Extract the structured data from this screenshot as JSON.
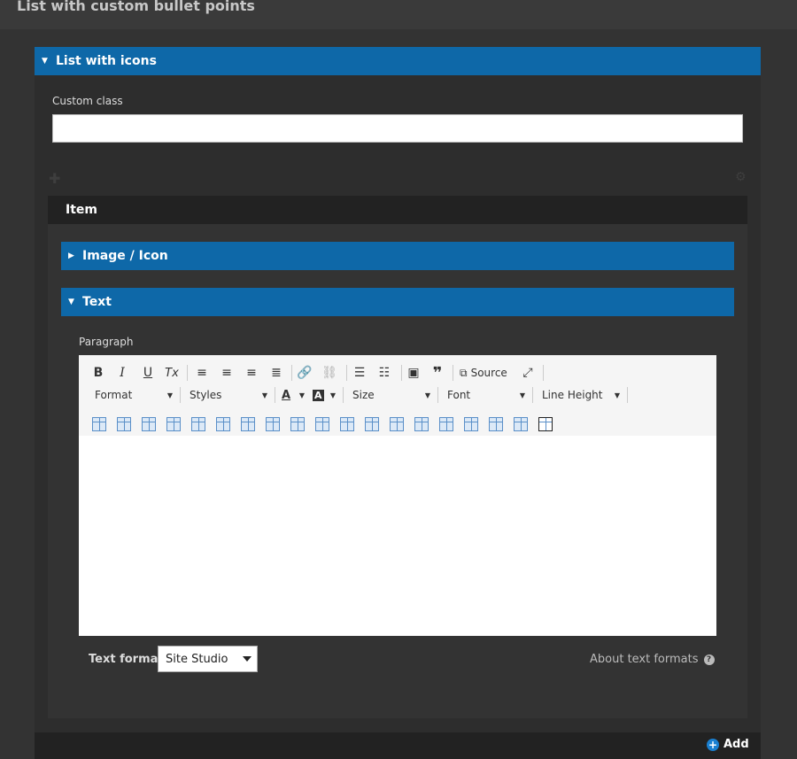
{
  "page": {
    "title": "List with custom bullet points"
  },
  "list_section": {
    "title": "List with icons",
    "expanded": true
  },
  "custom_class": {
    "label": "Custom class",
    "value": ""
  },
  "item": {
    "title": "Item"
  },
  "image_section": {
    "title": "Image / Icon",
    "expanded": false
  },
  "text_section": {
    "title": "Text",
    "expanded": true
  },
  "paragraph": {
    "label": "Paragraph"
  },
  "toolbar": {
    "source_label": "Source",
    "format_label": "Format",
    "styles_label": "Styles",
    "size_label": "Size",
    "font_label": "Font",
    "line_height_label": "Line Height",
    "bold_glyph": "B",
    "italic_glyph": "I",
    "underline_glyph": "U",
    "clear_format_glyph": "Tx",
    "text_color_glyph": "A",
    "bg_color_glyph": "A"
  },
  "text_format": {
    "label": "Text format",
    "selected": "Site Studio"
  },
  "about_formats": {
    "label": "About text formats"
  },
  "add_button": {
    "label": "Add"
  }
}
